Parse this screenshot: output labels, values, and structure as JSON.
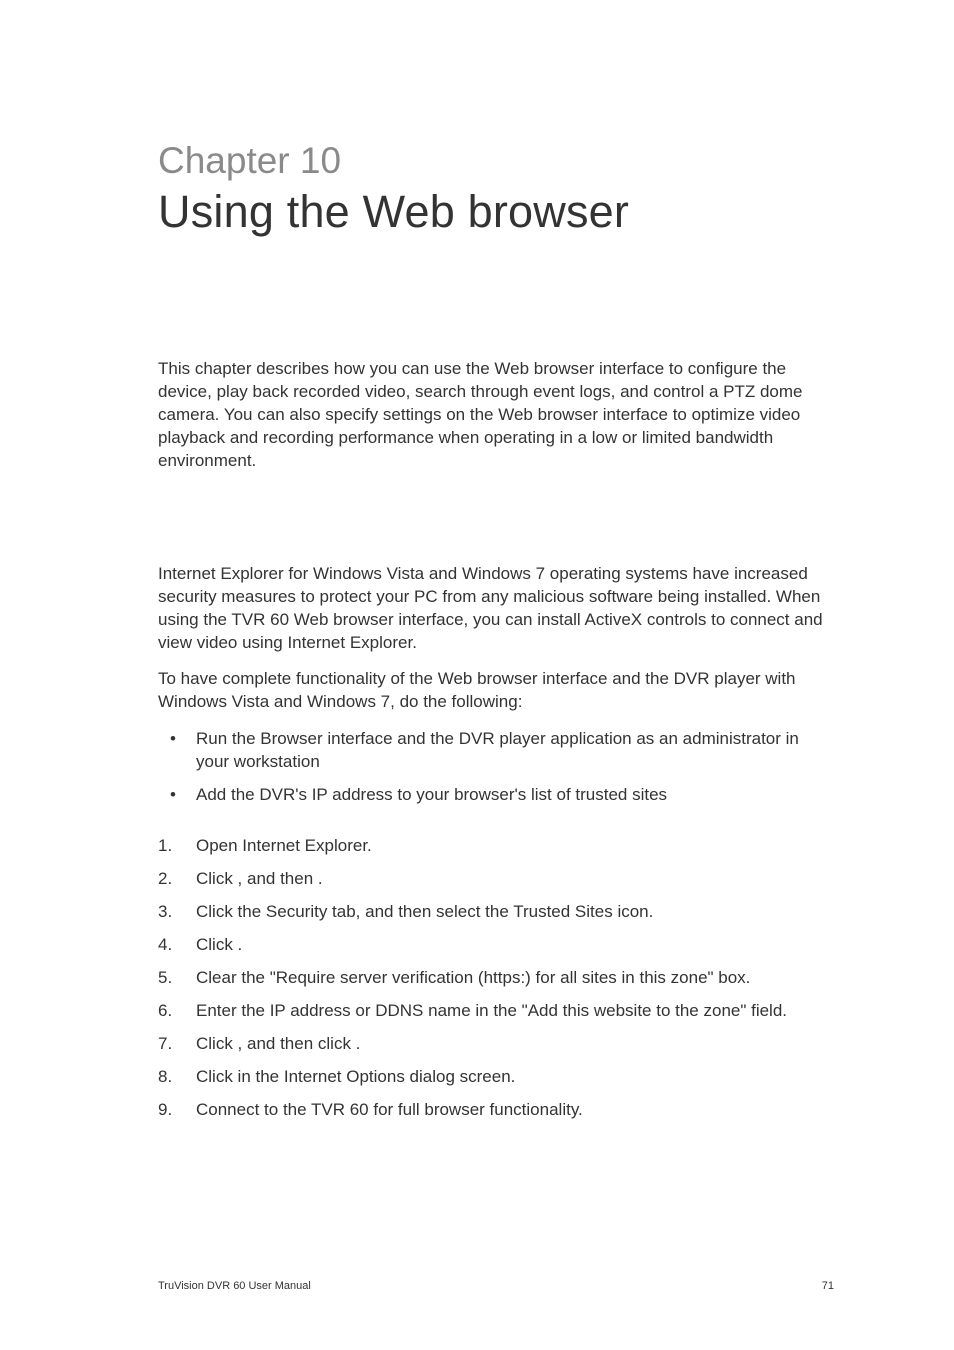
{
  "chapter": {
    "number": "Chapter 10",
    "title": "Using the Web browser"
  },
  "intro": "This chapter describes how you can use the Web browser interface to configure the device, play back recorded video, search through event logs, and control a PTZ dome camera. You can also specify settings on the Web browser interface to optimize video playback and recording performance when operating in a low or limited bandwidth environment.",
  "paras": [
    "Internet Explorer for Windows Vista and Windows 7 operating systems have increased security measures to protect your PC from any malicious software being installed. When using the TVR 60 Web browser interface, you can install ActiveX controls to connect and view video using Internet Explorer.",
    "To have complete functionality of the Web browser interface and the DVR player with Windows Vista and Windows 7, do the following:"
  ],
  "bullets": [
    "Run the Browser interface and the DVR player application as an administrator in your workstation",
    "Add the DVR's IP address to your browser's list of trusted sites"
  ],
  "steps": [
    "Open Internet Explorer.",
    "Click           , and then                              .",
    "Click the Security tab, and then select the Trusted Sites icon.",
    "Click         .",
    "Clear the \"Require server verification (https:) for all sites in this zone\" box.",
    "Enter the IP address or DDNS name in the \"Add this website to the zone\" field.",
    "Click        , and then click           .",
    "Click        in the Internet Options dialog screen.",
    "Connect to the TVR 60 for full browser functionality."
  ],
  "footer": {
    "left": "TruVision DVR 60 User Manual",
    "right": "71"
  }
}
